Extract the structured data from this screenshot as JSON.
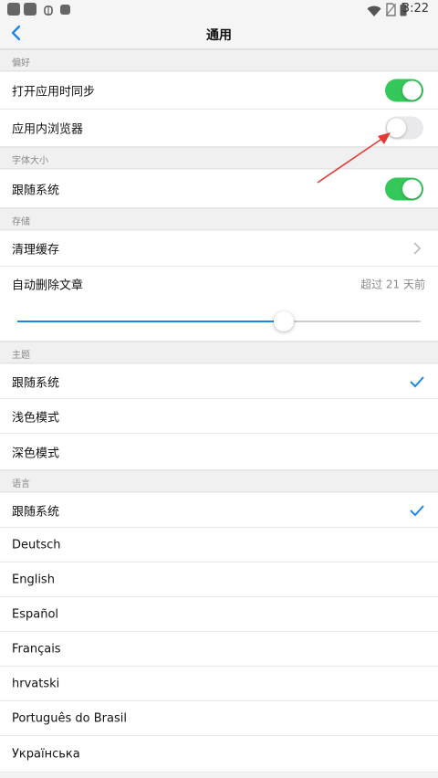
{
  "status_bar": {
    "time": "3:22"
  },
  "nav": {
    "title": "通用"
  },
  "sections": {
    "preferences": {
      "title": "偏好"
    },
    "font_size": {
      "title": "字体大小"
    },
    "storage": {
      "title": "存储"
    },
    "theme": {
      "title": "主题"
    },
    "language": {
      "title": "语言"
    }
  },
  "rows": {
    "sync_on_open": {
      "label": "打开应用时同步",
      "on": true
    },
    "in_app_browser": {
      "label": "应用内浏览器",
      "on": false
    },
    "follow_system_font": {
      "label": "跟随系统",
      "on": true
    },
    "clear_cache": {
      "label": "清理缓存"
    },
    "auto_delete": {
      "label": "自动删除文章",
      "value": "超过 21 天前",
      "slider_fraction": 0.66
    },
    "theme_options": [
      "跟随系统",
      "浅色模式",
      "深色模式"
    ],
    "theme_selected": 0,
    "language_options": [
      "跟随系统",
      "Deutsch",
      "English",
      "Español",
      "Français",
      "hrvatski",
      "Português do Brasil",
      "Українська"
    ],
    "language_selected": 0
  },
  "colors": {
    "toggle_on": "#34c759",
    "accent": "#1e88e5",
    "annotation_arrow": "#e53935"
  }
}
